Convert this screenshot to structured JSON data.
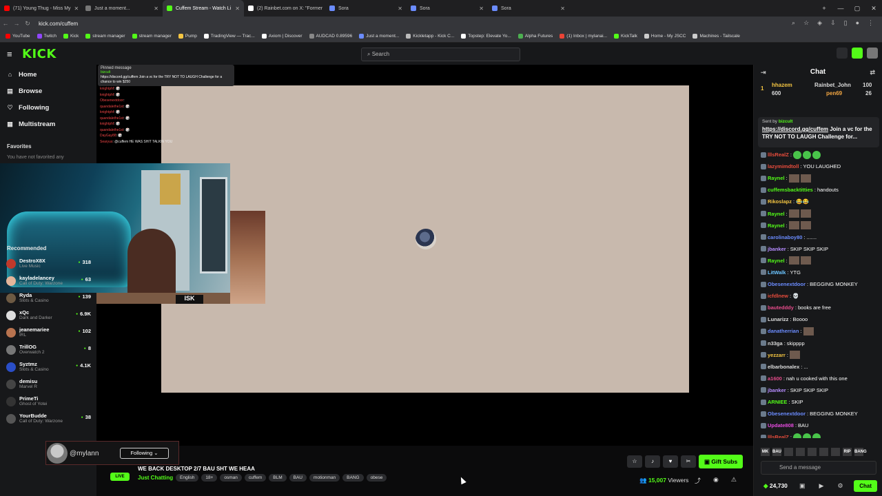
{
  "browser": {
    "tabs": [
      {
        "title": "(71) Young Thug - Miss My",
        "color": "#ff0000"
      },
      {
        "title": "Just a moment...",
        "color": "#777777"
      },
      {
        "title": "Cuffem Stream - Watch Li",
        "color": "#53fc18",
        "active": true
      },
      {
        "title": "(2) Rainbet.com on X: \"Former",
        "color": "#ffffff"
      },
      {
        "title": "Sora",
        "color": "#6b8cff"
      },
      {
        "title": "Sora",
        "color": "#6b8cff"
      },
      {
        "title": "Sora",
        "color": "#6b8cff"
      }
    ],
    "url": "kick.com/cuffem",
    "bookmarks": [
      {
        "label": "YouTube",
        "color": "#ff0000"
      },
      {
        "label": "Twitch",
        "color": "#9146ff"
      },
      {
        "label": "Kick",
        "color": "#53fc18"
      },
      {
        "label": "stream manager",
        "color": "#53fc18"
      },
      {
        "label": "stream manager",
        "color": "#53fc18"
      },
      {
        "label": "Pump",
        "color": "#f4c542"
      },
      {
        "label": "TradingView — Trac...",
        "color": "#ffffff"
      },
      {
        "label": "Axiom | Discover",
        "color": "#ffffff"
      },
      {
        "label": "AUDCAD 0.89596",
        "color": "#888888"
      },
      {
        "label": "Just a moment...",
        "color": "#6b8cff"
      },
      {
        "label": "Kickletapp - Kick C...",
        "color": "#bbbbbb"
      },
      {
        "label": "Topstep: Elevate Yo...",
        "color": "#ffffff"
      },
      {
        "label": "Alpha Futures",
        "color": "#4caf50"
      },
      {
        "label": "(1) Inbox | mylanai...",
        "color": "#ea4335"
      },
      {
        "label": "KickTalk",
        "color": "#53fc18"
      },
      {
        "label": "Home - My JSCC",
        "color": "#cccccc"
      },
      {
        "label": "Machines - Tailscale",
        "color": "#cccccc"
      }
    ]
  },
  "header": {
    "logo": "KICK",
    "search_placeholder": "Search"
  },
  "sidebar": {
    "nav": [
      {
        "label": "Home",
        "icon": "⌂"
      },
      {
        "label": "Browse",
        "icon": "▤"
      },
      {
        "label": "Following",
        "icon": "♡"
      },
      {
        "label": "Multistream",
        "icon": "▦"
      }
    ],
    "favorites_title": "Favorites",
    "favorites_empty": "You have not favorited any",
    "recommended_title": "Recommended",
    "recommended": [
      {
        "name": "DestroX8X",
        "game": "Live Music",
        "viewers": "318",
        "color": "#c0392b"
      },
      {
        "name": "kayladelancey",
        "game": "Call of Duty: Warzone",
        "viewers": "63",
        "color": "#e3b59a"
      },
      {
        "name": "Ryda",
        "game": "Slots & Casino",
        "viewers": "139",
        "color": "#6d5a43"
      },
      {
        "name": "xQc",
        "game": "Dark and Darker",
        "viewers": "6.9K",
        "color": "#dddddd"
      },
      {
        "name": "jeanemariee",
        "game": "IRL",
        "viewers": "102",
        "color": "#b8734f"
      },
      {
        "name": "TrillOG",
        "game": "Overwatch 2",
        "viewers": "8",
        "color": "#777777"
      },
      {
        "name": "Syztmz",
        "game": "Slots & Casino",
        "viewers": "4.1K",
        "color": "#2a4ec7"
      },
      {
        "name": "demisu",
        "game": "Marvel R",
        "viewers": "",
        "color": "#444444"
      },
      {
        "name": "PrimeTi",
        "game": "Ghost of Yotei",
        "viewers": "",
        "color": "#333333"
      },
      {
        "name": "YourBudde",
        "game": "Call of Duty: Warzone",
        "viewers": "38",
        "color": "#555555"
      }
    ]
  },
  "overlay_chat": {
    "pinned_title": "Pinned message",
    "pinned_user": "bizcult",
    "pinned_text": "https://discord.gg/cuffem Join a vc for the TRY NOT TO LAUGH Challenge for a chance to win $250",
    "lines": [
      {
        "user": "knightphf",
        "text": "🎲"
      },
      {
        "user": "knightphf",
        "text": "🎲"
      },
      {
        "user": "Obesenextdoor",
        "text": ""
      },
      {
        "user": "quandalethe1st",
        "text": "🎲"
      },
      {
        "user": "knightphf",
        "text": "🎲"
      },
      {
        "user": "quandalethe1st",
        "text": "🎲"
      },
      {
        "user": "knightphf",
        "text": "🎲"
      },
      {
        "user": "quandalethe1st",
        "text": "🎲"
      },
      {
        "user": "DayGay88",
        "text": "🎲"
      },
      {
        "user": "Searyus",
        "text": "@cuffem HE WAS SHIT TALKIN YOU"
      }
    ],
    "cam_label": "ISK"
  },
  "stream": {
    "handle": "@mylann",
    "follow_label": "Following",
    "live_label": "LIVE",
    "title": "WE BACK DESKTOP 2/7 BAU SHT WE HEAA",
    "category": "Just Chatting",
    "tags": [
      "English",
      "18+",
      "osman",
      "cuffem",
      "BLM",
      "BAU",
      "motionman",
      "BANG",
      "obese"
    ],
    "gift_label": "Gift Subs",
    "viewers": "15,007",
    "viewers_label": "Viewers"
  },
  "chat": {
    "title": "Chat",
    "leaderboard": [
      {
        "rank": "1",
        "name": "hhazem",
        "points": "600",
        "color": "#f4c542"
      },
      {
        "name": "Rainbet_John",
        "points": "100",
        "color": "#dddddd"
      },
      {
        "name": "pen69",
        "points": "26",
        "color": "#f4a742"
      }
    ],
    "pinned_sender_label": "Sent by",
    "pinned_sender": "bizcult",
    "pinned_link": "https://discord.gg/cuffem",
    "pinned_text": " Join a vc for the TRY NOT TO LAUGH Challenge for...",
    "messages": [
      {
        "user": "lllsRealZ",
        "text": "",
        "color": "#e74c3c",
        "emotes": 3
      },
      {
        "user": "lazymimdtoll",
        "text": "YOU LAUGHED",
        "color": "#e74c3c"
      },
      {
        "user": "Raynel",
        "text": "",
        "color": "#53fc18",
        "stickers": 2
      },
      {
        "user": "cuffemsbacktitties",
        "text": "handouts",
        "color": "#53fc18"
      },
      {
        "user": "Rikoslapz",
        "text": "😂😂",
        "color": "#f4c542"
      },
      {
        "user": "Raynel",
        "text": "",
        "color": "#53fc18",
        "stickers": 2
      },
      {
        "user": "Raynel",
        "text": "",
        "color": "#53fc18",
        "stickers": 2
      },
      {
        "user": "carolinaboy80",
        "text": ".......",
        "color": "#6b8cff"
      },
      {
        "user": "jbanker",
        "text": "SKIP SKIP SKIP",
        "color": "#b68cff"
      },
      {
        "user": "Raynel",
        "text": "",
        "color": "#53fc18",
        "stickers": 2
      },
      {
        "user": "LitWalk",
        "text": "YTG",
        "color": "#6bc4ff"
      },
      {
        "user": "Obesenextdoor",
        "text": "BEGGING MONKEY",
        "color": "#6b8cff"
      },
      {
        "user": "icfdlnew",
        "text": "💀",
        "color": "#e74c3c"
      },
      {
        "user": "bautedddy",
        "text": "books are free",
        "color": "#e74c8c"
      },
      {
        "user": "Lunarizz",
        "text": "Boooo",
        "color": "#dddddd"
      },
      {
        "user": "danatherrian",
        "text": "",
        "color": "#6b8cff",
        "stickers": 1
      },
      {
        "user": "n33ga",
        "text": "skipppp",
        "color": "#dddddd"
      },
      {
        "user": "yezzarr",
        "text": "",
        "color": "#f4c542",
        "stickers": 1
      },
      {
        "user": "elbarbonalex",
        "text": "...",
        "color": "#dddddd"
      },
      {
        "user": "a1600",
        "text": "nah u cooked with this one",
        "color": "#e74c8c"
      },
      {
        "user": "jbanker",
        "text": "SKIP SKIP SKIP",
        "color": "#b68cff"
      },
      {
        "user": "ARNIEE",
        "text": "SKIP",
        "color": "#53fc18"
      },
      {
        "user": "Obesenextdoor",
        "text": "BEGGING MONKEY",
        "color": "#6b8cff"
      },
      {
        "user": "Update808",
        "text": "BAU",
        "color": "#e74ce0"
      },
      {
        "user": "lllsRealZ",
        "text": "",
        "color": "#e74c3c",
        "emotes": 3
      }
    ],
    "emote_bar": [
      "MK",
      "BAU",
      "",
      "",
      "",
      "",
      "",
      "RIP",
      "BANG"
    ],
    "input_placeholder": "Send a message",
    "balance": "24,730",
    "chat_button": "Chat"
  },
  "colors": {
    "brand": "#53fc18",
    "canvas": "#c8b9ad"
  }
}
